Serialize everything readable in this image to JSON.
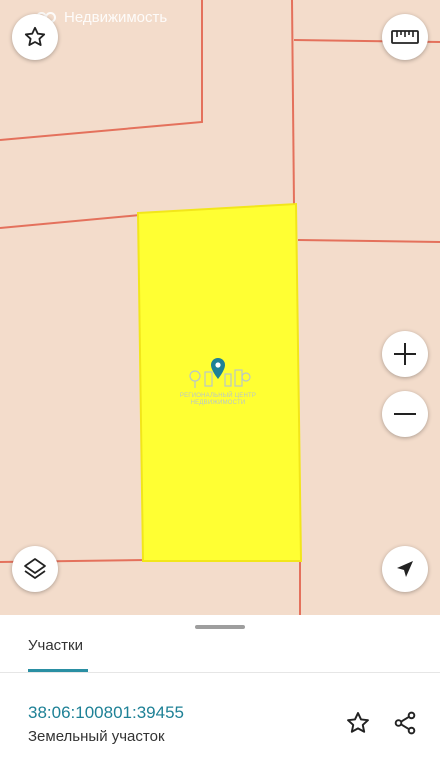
{
  "app": {
    "brand_label": "Недвижимость"
  },
  "map": {
    "background_color": "#f3dccb",
    "boundary_color": "#e4715c",
    "parcel_fill_color": "#ffff33",
    "parcel_stroke_color": "#f2e61a",
    "watermark_line1": "РЕГИОНАЛЬНЫЙ ЦЕНТР",
    "watermark_line2": "НЕДВИЖИМОСТИ",
    "controls": {
      "favorite_icon": "star-outline-icon",
      "ruler_icon": "ruler-icon",
      "zoom_in_icon": "plus-icon",
      "zoom_out_icon": "minus-icon",
      "layers_icon": "layers-icon",
      "location_icon": "navigation-arrow-icon"
    }
  },
  "sheet": {
    "tab_label": "Участки",
    "accent_color": "#2a8fa3",
    "cadastral_number": "38:06:100801:39455",
    "parcel_type": "Земельный участок",
    "actions": {
      "favorite_icon": "star-outline-icon",
      "share_icon": "share-icon"
    }
  }
}
